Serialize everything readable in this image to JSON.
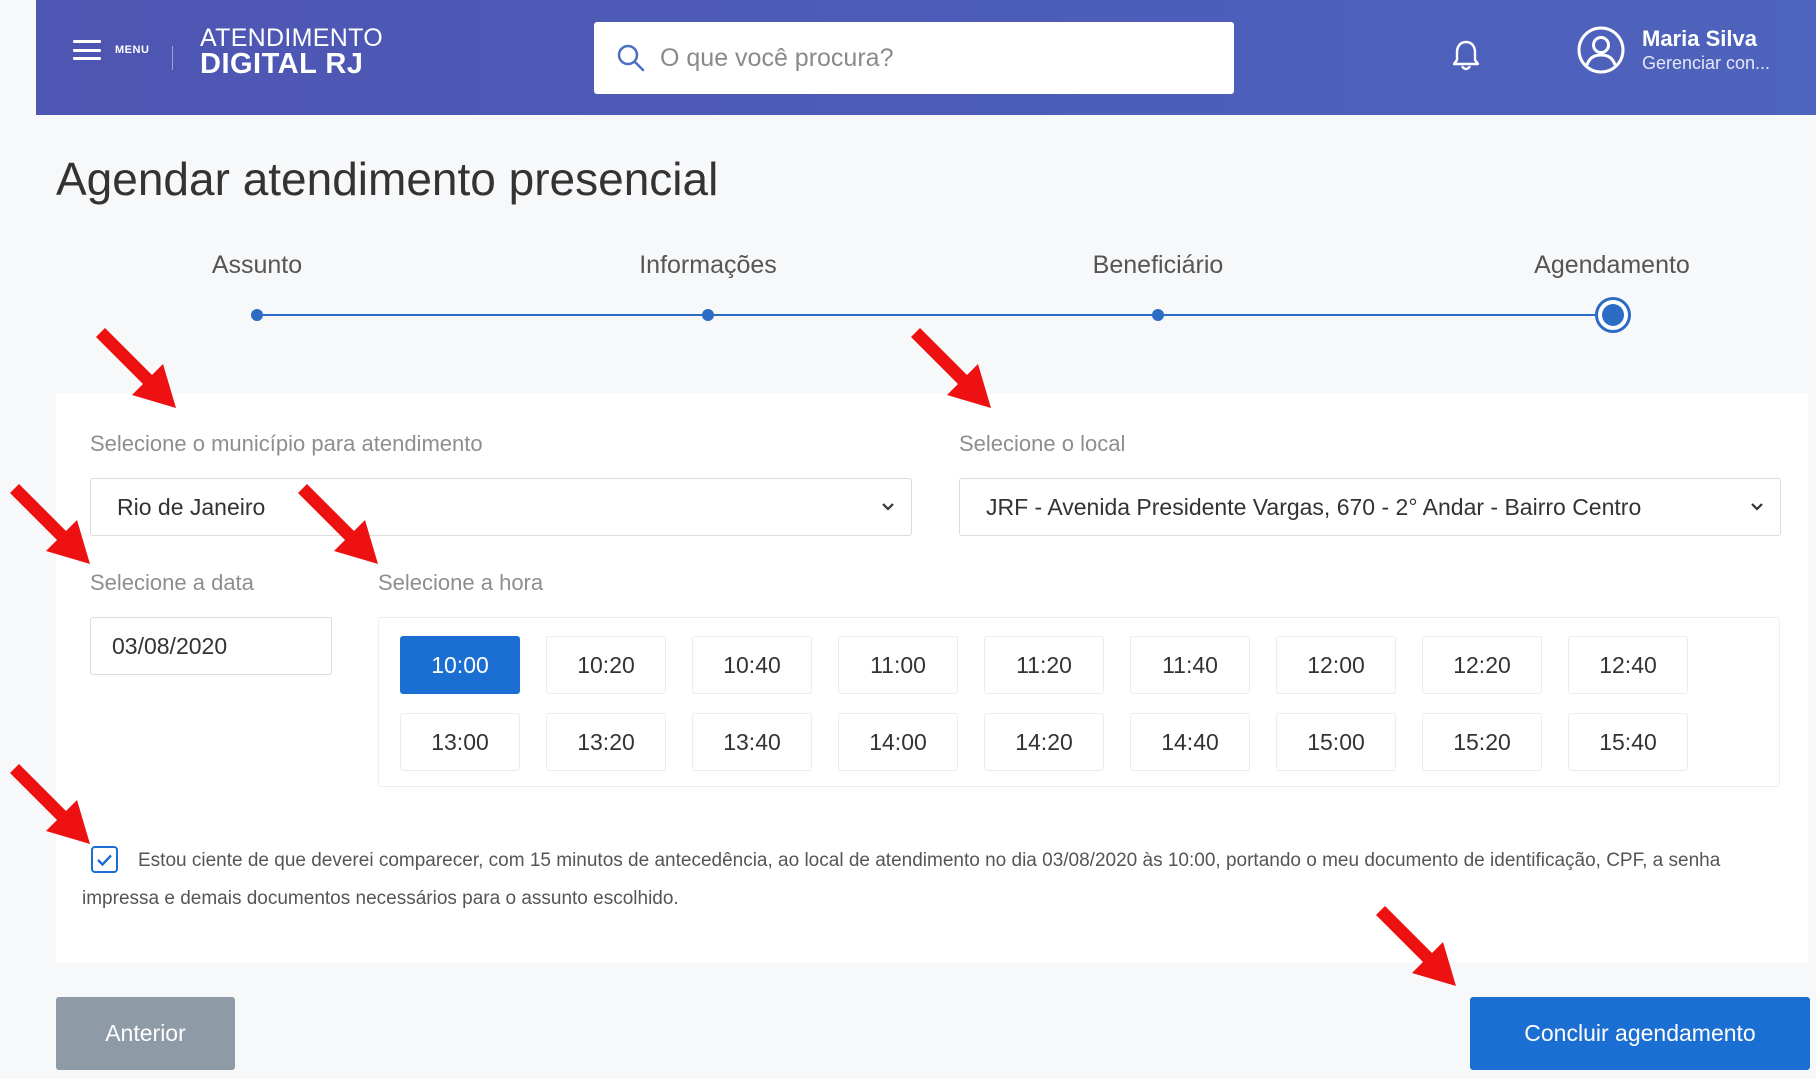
{
  "header": {
    "menu_label": "MENU",
    "logo_line1": "ATENDIMENTO",
    "logo_line2": "DIGITAL RJ",
    "search_placeholder": "O que você procura?",
    "user_name": "Maria Silva",
    "user_sub": "Gerenciar con..."
  },
  "page_title": "Agendar atendimento presencial",
  "steps": [
    {
      "label": "Assunto"
    },
    {
      "label": "Informações"
    },
    {
      "label": "Beneficiário"
    },
    {
      "label": "Agendamento"
    }
  ],
  "form": {
    "municipio_label": "Selecione o município para atendimento",
    "municipio_value": "Rio de Janeiro",
    "local_label": "Selecione o local",
    "local_value": "JRF - Avenida Presidente Vargas, 670 - 2° Andar - Bairro Centro",
    "data_label": "Selecione a data",
    "data_value": "03/08/2020",
    "hora_label": "Selecione a hora",
    "times": [
      "10:00",
      "10:20",
      "10:40",
      "11:00",
      "11:20",
      "11:40",
      "12:00",
      "12:20",
      "12:40",
      "13:00",
      "13:20",
      "13:40",
      "14:00",
      "14:20",
      "14:40",
      "15:00",
      "15:20",
      "15:40"
    ],
    "selected_time": "10:00",
    "consent_checked": true,
    "consent_text": "Estou ciente de que deverei comparecer, com 15 minutos de antecedência, ao local de atendimento no dia 03/08/2020 às 10:00, portando o meu documento de identificação, CPF, a senha impressa e demais documentos necessários para o assunto escolhido."
  },
  "buttons": {
    "prev": "Anterior",
    "next": "Concluir agendamento"
  },
  "colors": {
    "header": "#4e58b4",
    "primary": "#1c6fd2",
    "secondary_button": "#8e9aa6",
    "annotation_arrow": "#ee1111"
  }
}
